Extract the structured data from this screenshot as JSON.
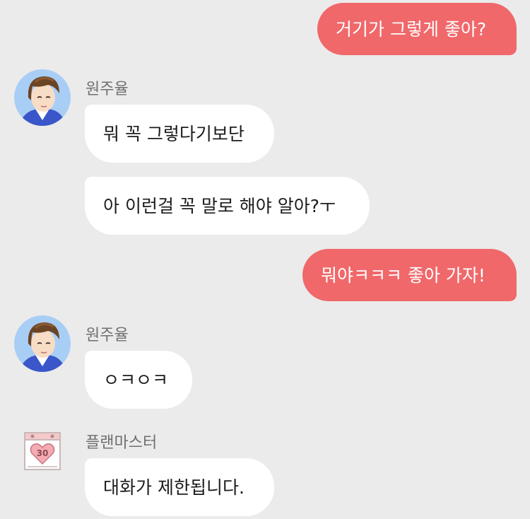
{
  "messages": [
    {
      "sender": "me",
      "text": "거기가 그렇게 좋아?"
    },
    {
      "sender": "원주율",
      "text": "뭐 꼭 그렇다기보단"
    },
    {
      "sender": "원주율",
      "text": "아 이런걸 꼭 말로 해야 알아?ㅜ"
    },
    {
      "sender": "me",
      "text": "뭐야ㅋㅋㅋ 좋아 가자!"
    },
    {
      "sender": "원주율",
      "text": "ㅇㅋㅇㅋ"
    },
    {
      "sender": "플랜마스터",
      "text": "대화가 제한됩니다."
    }
  ],
  "senders": {
    "character": "원주율",
    "system": "플랜마스터"
  },
  "calendar_icon": {
    "day": "30",
    "icon": "heart-calendar-icon"
  },
  "colors": {
    "background": "#ebebeb",
    "my_bubble": "#f0686a",
    "other_bubble": "#ffffff",
    "name_text": "#6f6f6f"
  }
}
